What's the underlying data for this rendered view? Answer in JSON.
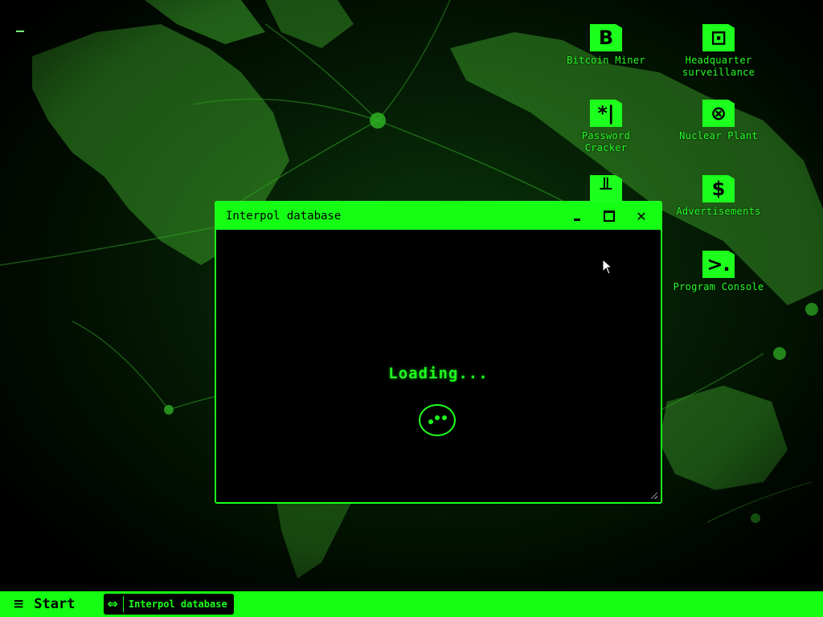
{
  "colors": {
    "accent": "#14ff14",
    "icon_fill": "#1dff1d",
    "text_green": "#24ff24",
    "background": "#000000"
  },
  "desktop": {
    "icons": [
      {
        "name": "bitcoin-miner",
        "label": "Bitcoin Miner",
        "glyph": "B",
        "icon": "bitcoin-miner-icon"
      },
      {
        "name": "headquarter-surveillance",
        "label": "Headquarter surveillance",
        "glyph": "⊡",
        "icon": "surveillance-icon"
      },
      {
        "name": "password-cracker",
        "label": "Password Cracker",
        "glyph": "*|",
        "icon": "password-cracker-icon"
      },
      {
        "name": "nuclear-plant",
        "label": "Nuclear Plant",
        "glyph": "⊗",
        "icon": "nuclear-plant-icon"
      },
      {
        "name": "unnamed-folder",
        "label": "",
        "glyph": "╨",
        "icon": "terminal-ground-icon"
      },
      {
        "name": "advertisements",
        "label": "Advertisements",
        "glyph": "$",
        "icon": "dollar-icon"
      },
      {
        "name": "program-console",
        "label": "Program Console",
        "glyph": ">.",
        "icon": "console-icon"
      }
    ]
  },
  "window": {
    "title": "Interpol database",
    "controls": {
      "minimize": "minimize-icon",
      "maximize": "maximize-icon",
      "close": "close-icon",
      "close_glyph": "✕"
    },
    "loading_text": "Loading..."
  },
  "taskbar": {
    "start_icon": "≡",
    "start_label": "Start",
    "task_icon": "⇔",
    "task_label": "Interpol database"
  }
}
